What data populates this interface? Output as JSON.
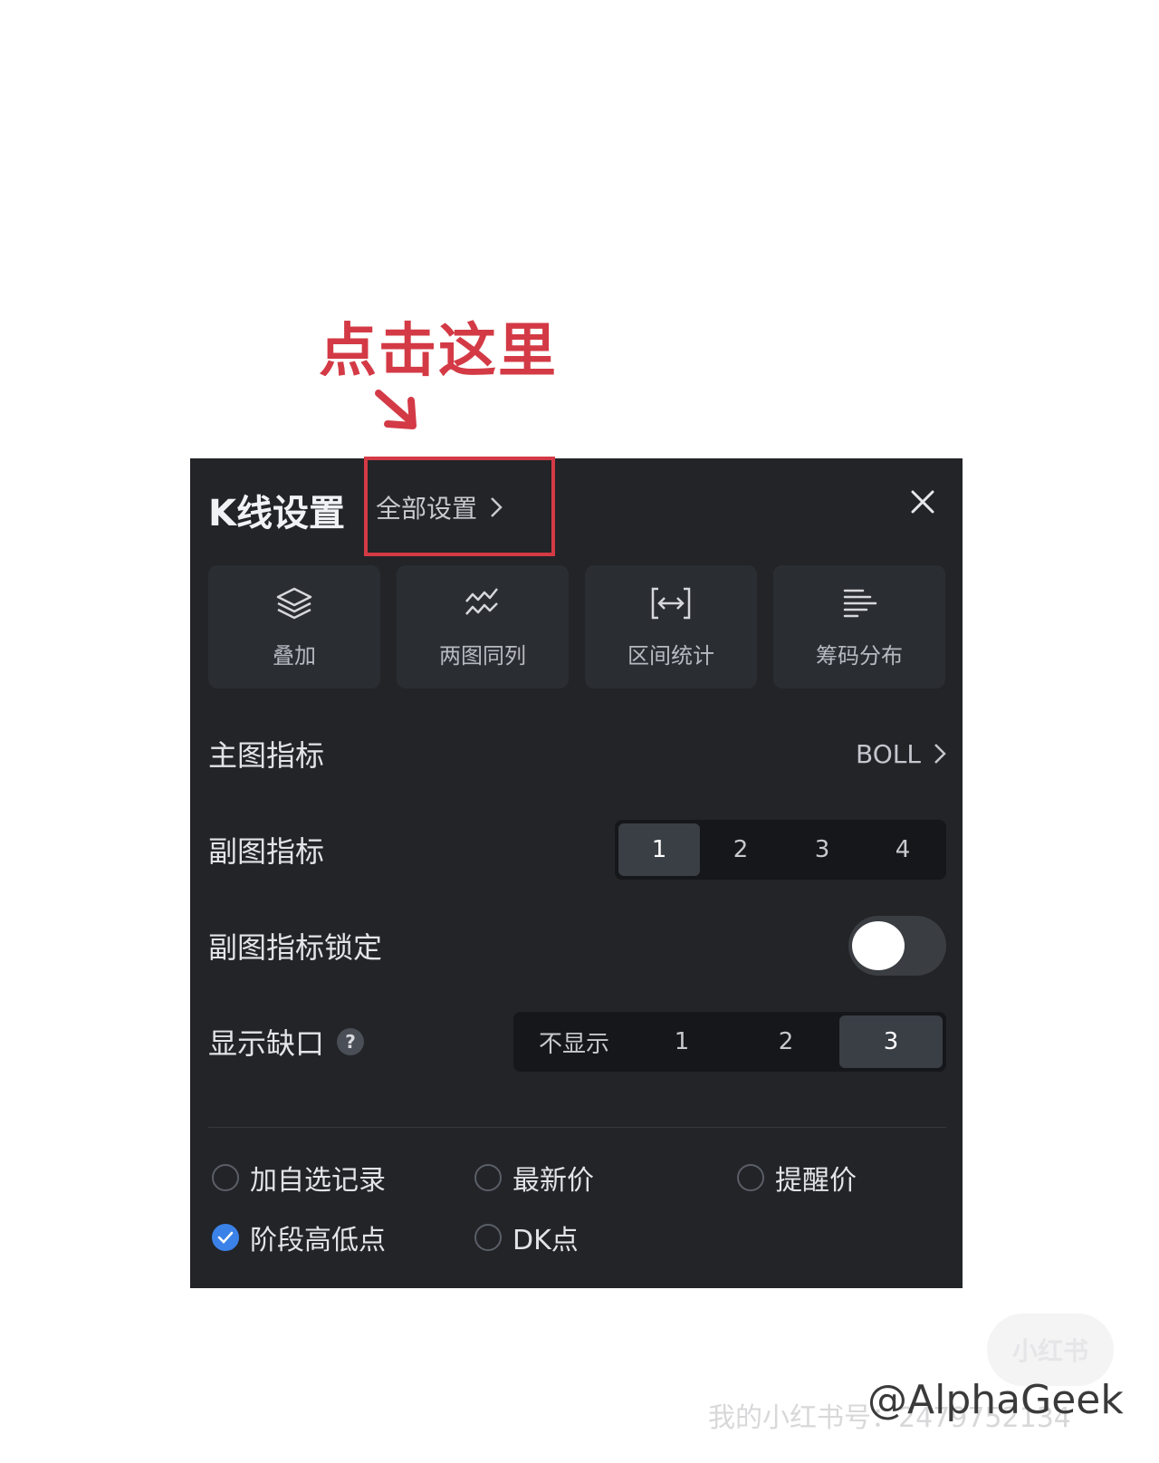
{
  "annotation": {
    "text": "点击这里",
    "color": "#d33a45"
  },
  "panel": {
    "title": "K线设置",
    "all_settings_label": "全部设置",
    "tools": [
      {
        "label": "叠加",
        "icon": "layers-icon"
      },
      {
        "label": "两图同列",
        "icon": "dual-chart-icon"
      },
      {
        "label": "区间统计",
        "icon": "range-stat-icon"
      },
      {
        "label": "筹码分布",
        "icon": "chip-distribution-icon"
      }
    ],
    "main_indicator": {
      "label": "主图指标",
      "value": "BOLL"
    },
    "sub_indicator": {
      "label": "副图指标",
      "options": [
        "1",
        "2",
        "3",
        "4"
      ],
      "selected": "1"
    },
    "sub_lock": {
      "label": "副图指标锁定",
      "on": false
    },
    "gap": {
      "label": "显示缺口",
      "help": "?",
      "options": [
        "不显示",
        "1",
        "2",
        "3"
      ],
      "selected": "3"
    },
    "checkboxes": [
      {
        "label": "加自选记录",
        "checked": false
      },
      {
        "label": "最新价",
        "checked": false
      },
      {
        "label": "提醒价",
        "checked": false
      },
      {
        "label": "阶段高低点",
        "checked": true
      },
      {
        "label": "DK点",
        "checked": false
      }
    ],
    "accent": "#3b82e8"
  },
  "watermark": {
    "logo": "小红书",
    "text": "我的小红书号：2479752134",
    "handle": "@AlphaGeek"
  }
}
